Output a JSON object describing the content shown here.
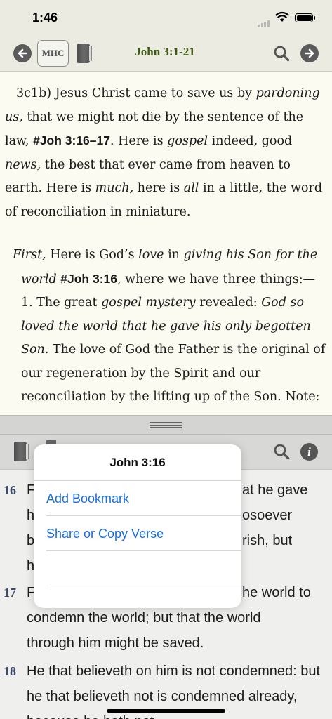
{
  "status": {
    "time": "1:46"
  },
  "toolbar": {
    "mhc_label": "MHC",
    "title": "John 3:1-21",
    "back_icon": "back-arrow-icon",
    "forward_icon": "forward-arrow-icon",
    "search_icon": "search-icon"
  },
  "commentary": {
    "p1": {
      "a": "3c1b) Jesus Christ came to save us by ",
      "b": "pardoning us,",
      "c": " that we might not die by the sentence of the law, ",
      "d": "#Joh 3:16–17",
      "e": ". Here is ",
      "f": "gospel",
      "g": " indeed, good ",
      "h": "news,",
      "i": " the best that ever came from heaven to earth. Here is ",
      "j": "much,",
      "k": " here is ",
      "l": "all",
      "m": " in a little, the word of reconciliation in miniature."
    },
    "p2": {
      "a": "First,",
      "b": " Here is God’s ",
      "c": "love",
      "d": " in ",
      "e": "giving his Son for the world",
      "f": " ",
      "g": "#Joh 3:16",
      "h": ", where we have three things:—",
      "i": "1. The great ",
      "j": "gospel mystery",
      "k": " revealed: ",
      "l": "God so loved the world that he gave his only begotten Son.",
      "m": "  The love of God the Father is the original of our regeneration by the Spirit and our reconciliation by the lifting up of the Son.  Note:"
    }
  },
  "bible": {
    "verses": [
      {
        "num": "16",
        "text": "For God so loved the world, that he gave his only begotten Son, that whosoever believeth in him should not perish, but have everlasting life."
      },
      {
        "num": "17",
        "text": "For God sent not his Son into the world to condemn the world; but that the world through him might be saved."
      },
      {
        "num": "18",
        "text": "He that believeth on him is not condemned: but he that believeth not is condemned already, because he hath not"
      }
    ],
    "visible_fragments": {
      "v16_l1": "at he gave",
      "v16_l2": "osoever",
      "v16_l3": "rish, but",
      "v17_l1": "he world to"
    },
    "search_icon": "search-icon",
    "info_icon": "info-icon",
    "info_glyph": "i"
  },
  "popup": {
    "title": "John 3:16",
    "items": [
      {
        "label": "Add Bookmark"
      },
      {
        "label": "Share or Copy Verse"
      },
      {
        "label": ""
      }
    ]
  }
}
